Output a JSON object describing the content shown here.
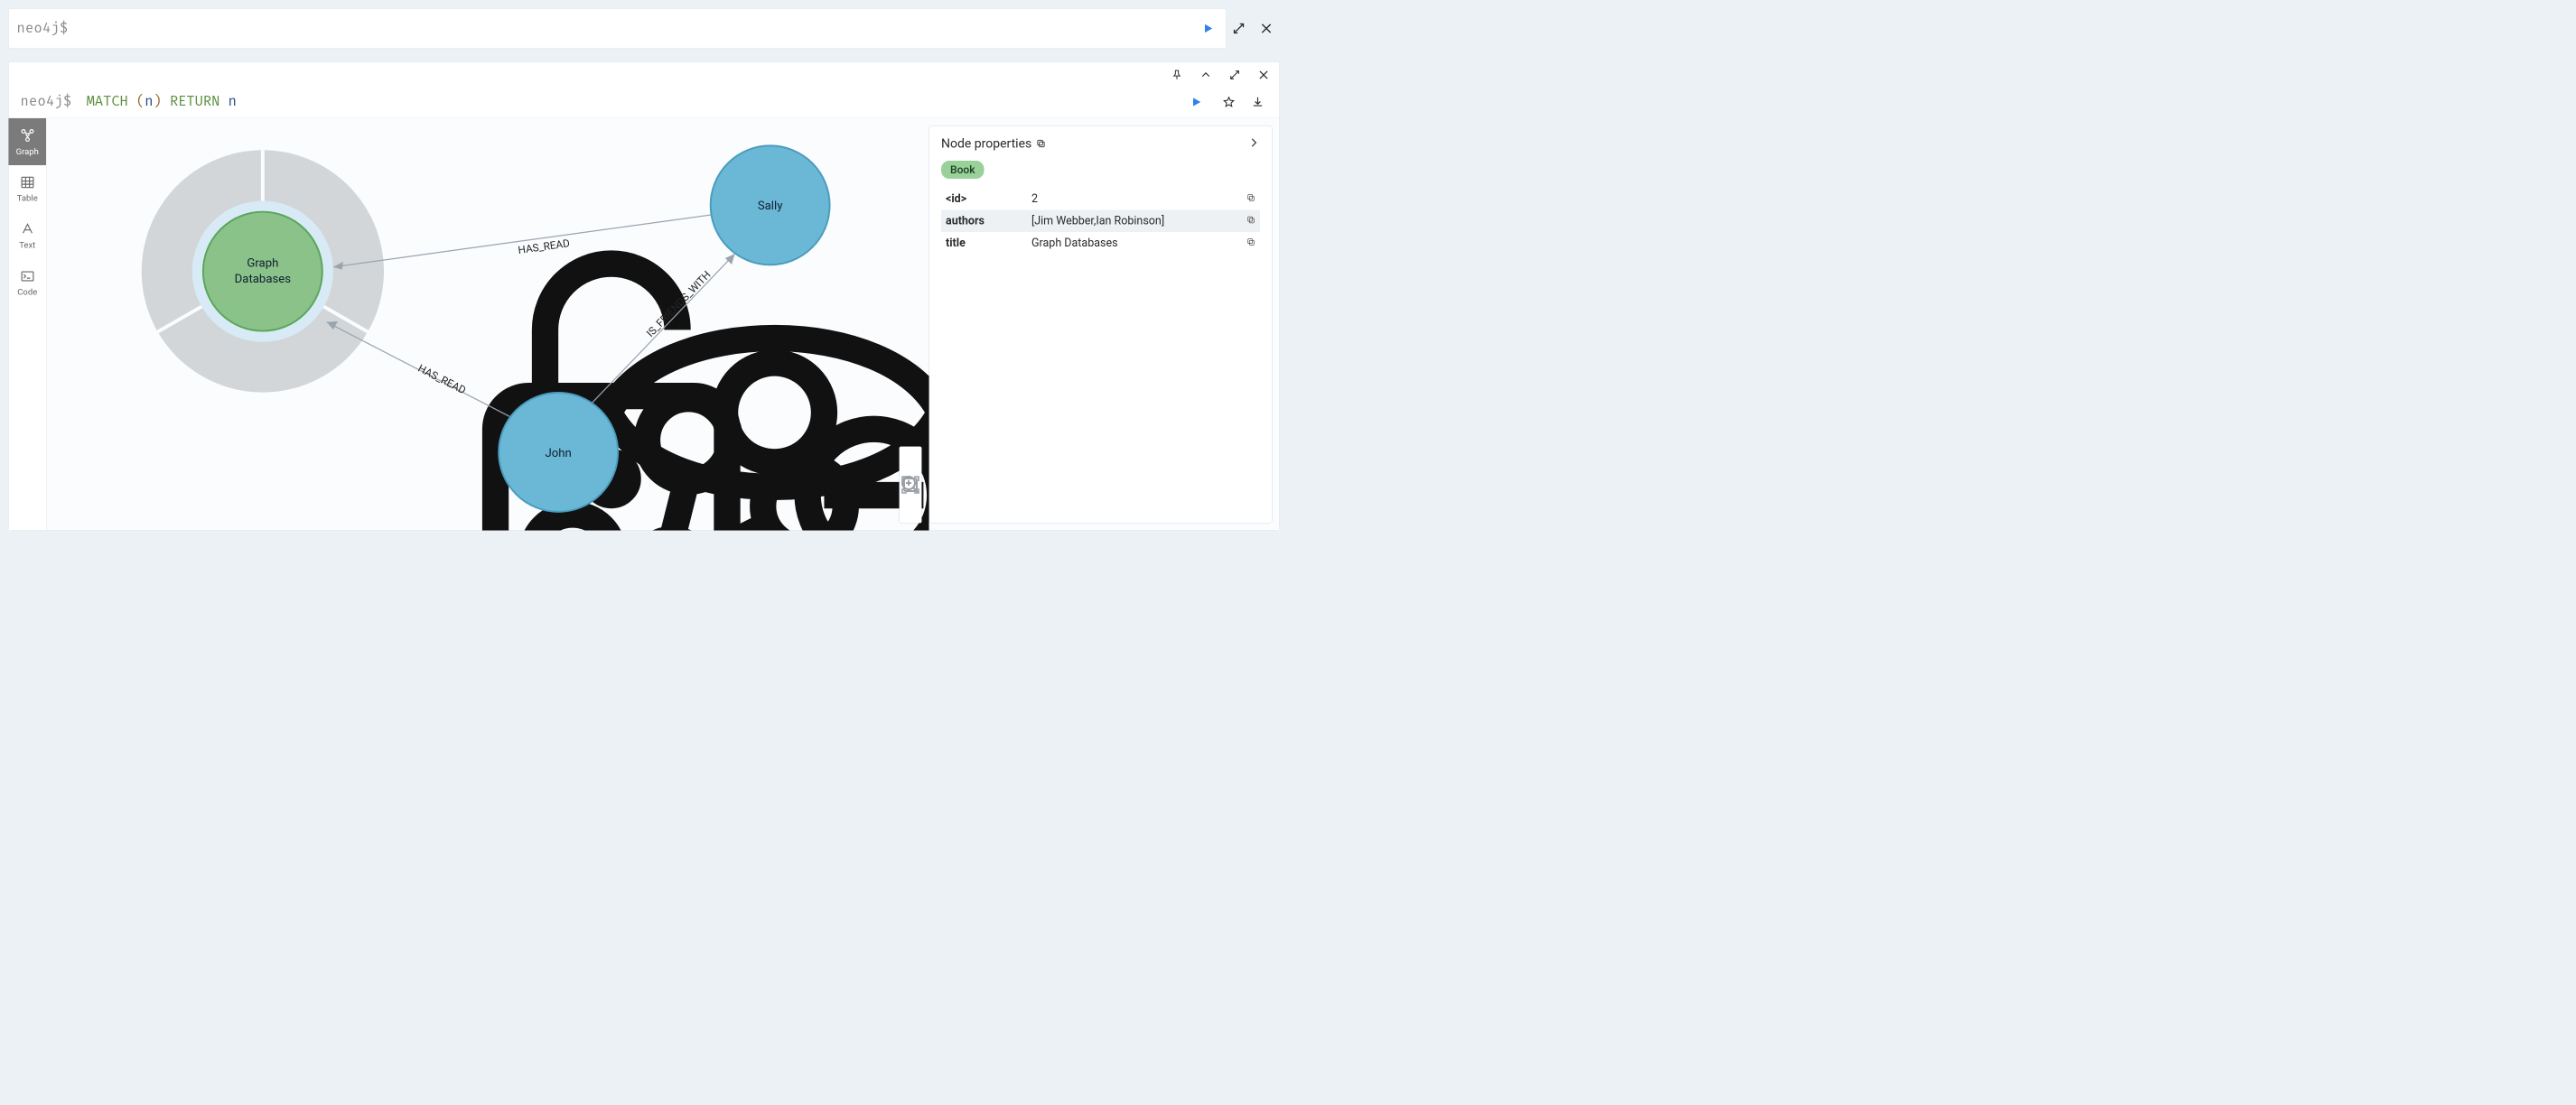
{
  "prompt": "neo4j$",
  "executed_query": {
    "keyword1": "MATCH",
    "paren_open": "(",
    "ident": "n",
    "paren_close": ")",
    "keyword2": "RETURN",
    "ident2": "n"
  },
  "view_tabs": {
    "graph": "Graph",
    "table": "Table",
    "text": "Text",
    "code": "Code"
  },
  "graph": {
    "nodes": {
      "book": "Graph\nDatabases",
      "book_line1": "Graph",
      "book_line2": "Databases",
      "sally": "Sally",
      "john": "John"
    },
    "edges": {
      "sally_book": "HAS_READ",
      "john_book": "HAS_READ",
      "john_sally": "IS_FRIENDS_WITH"
    }
  },
  "properties_panel": {
    "title": "Node properties",
    "label": "Book",
    "rows": {
      "id_key": "<id>",
      "id_val": "2",
      "authors_key": "authors",
      "authors_val": "[Jim Webber,Ian Robinson]",
      "title_key": "title",
      "title_val": "Graph Databases"
    }
  }
}
